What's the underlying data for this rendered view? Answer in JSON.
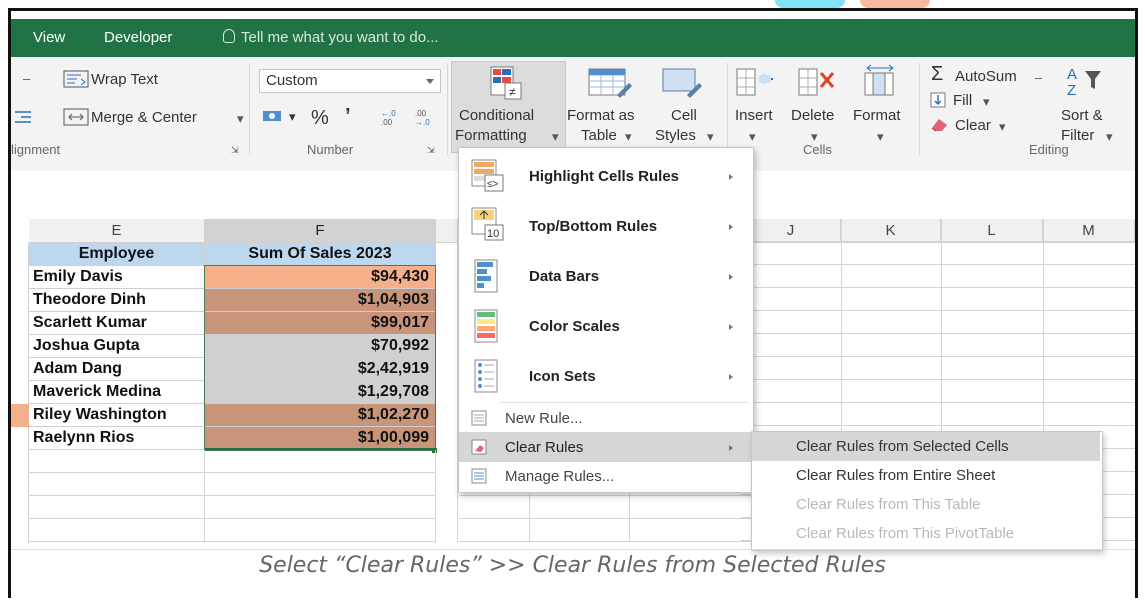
{
  "tabs": [
    "View",
    "Developer"
  ],
  "tell_me": "Tell me what you want to do...",
  "ribbon": {
    "wrap_text": "Wrap Text",
    "merge_center": "Merge & Center",
    "alignment_label": "lignment",
    "number_format": "Custom",
    "percent": "%",
    "comma": "’",
    "number_label": "Number",
    "cond_fmt_1": "Conditional",
    "cond_fmt_2": "Formatting",
    "format_table_1": "Format as",
    "format_table_2": "Table",
    "cell_styles_1": "Cell",
    "cell_styles_2": "Styles",
    "insert": "Insert",
    "delete": "Delete",
    "format": "Format",
    "cells_label": "Cells",
    "autosum": "AutoSum",
    "fill": "Fill",
    "clear": "Clear",
    "sort_1": "Sort &",
    "sort_2": "Filter",
    "editing_label": "Editing"
  },
  "columns": [
    "E",
    "F",
    "J",
    "K",
    "L",
    "M"
  ],
  "table": {
    "headers": [
      "Employee",
      "Sum Of Sales 2023"
    ],
    "rows": [
      {
        "name": "Emily Davis",
        "sales": "$94,430"
      },
      {
        "name": "Theodore Dinh",
        "sales": "$1,04,903"
      },
      {
        "name": "Scarlett Kumar",
        "sales": "$99,017"
      },
      {
        "name": "Joshua Gupta",
        "sales": "$70,992"
      },
      {
        "name": "Adam Dang",
        "sales": "$2,42,919"
      },
      {
        "name": "Maverick Medina",
        "sales": "$1,29,708"
      },
      {
        "name": "Riley Washington",
        "sales": "$1,02,270"
      },
      {
        "name": "Raelynn Rios",
        "sales": "$1,00,099"
      }
    ]
  },
  "menu": {
    "highlight": "Highlight Cells Rules",
    "topbottom": "Top/Bottom Rules",
    "databars": "Data Bars",
    "colorscales": "Color Scales",
    "iconsets": "Icon Sets",
    "newrule": "New Rule...",
    "clearrules": "Clear Rules",
    "managerules": "Manage Rules..."
  },
  "submenu": [
    "Clear Rules from Selected Cells",
    "Clear Rules from Entire Sheet",
    "Clear Rules from This Table",
    "Clear Rules from This PivotTable"
  ],
  "caption": "Select “Clear Rules” >> Clear Rules from Selected Rules",
  "colors": {
    "tab_green": "#217346",
    "header_blue": "#bdd7ee",
    "salmon_light": "#f4b08a",
    "brown": "#c9957a",
    "grey_cell": "#d0d0d0"
  }
}
